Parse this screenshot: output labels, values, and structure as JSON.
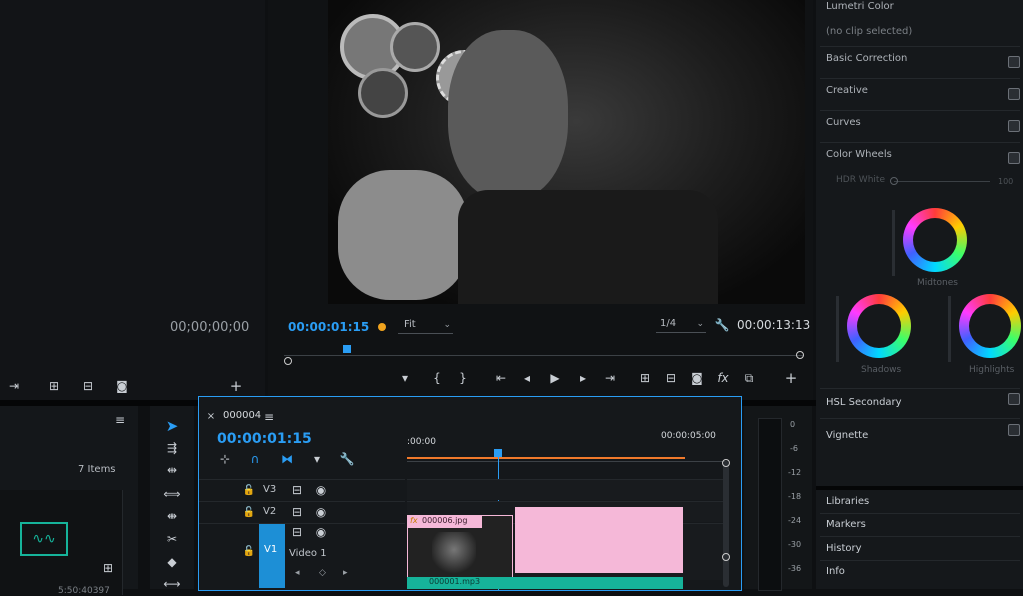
{
  "source_monitor": {
    "timecode": "00;00;00;00"
  },
  "program_monitor": {
    "timecode": "00:00:01:15",
    "fit_label": "Fit",
    "resolution": "1/4",
    "duration": "00:00:13:13"
  },
  "project_panel": {
    "items_count": "7 Items",
    "partial_text": "5:50:40397"
  },
  "timeline": {
    "sequence_name": "000004",
    "timecode": "00:00:01:15",
    "ruler_start": ":00:00",
    "ruler_end": "00:00:05:00",
    "tracks": [
      {
        "label": "V3"
      },
      {
        "label": "V2"
      },
      {
        "label": "V1",
        "name": "Video 1"
      }
    ],
    "clips": {
      "image_clip": "000006.jpg",
      "audio_clip": "000001.mp3"
    }
  },
  "audio_meter": {
    "ticks": [
      "0",
      "-6",
      "-12",
      "-18",
      "-24",
      "-30",
      "-36"
    ]
  },
  "lumetri": {
    "title": "Lumetri Color",
    "subtitle": "(no clip selected)",
    "sections": [
      "Basic Correction",
      "Creative",
      "Curves",
      "Color Wheels"
    ],
    "hdr_white": "HDR White",
    "hdr_value": "100",
    "wheels": {
      "midtones": "Midtones",
      "shadows": "Shadows",
      "highlights": "Highlights"
    },
    "lower_sections": [
      "HSL Secondary",
      "Vignette"
    ],
    "panels": [
      "Libraries",
      "Markers",
      "History",
      "Info"
    ]
  },
  "colors": {
    "accent_blue": "#2a9df4",
    "clip_pink": "#f5b8d8",
    "audio_green": "#16b39a",
    "playhead_orange": "#f0792b"
  }
}
